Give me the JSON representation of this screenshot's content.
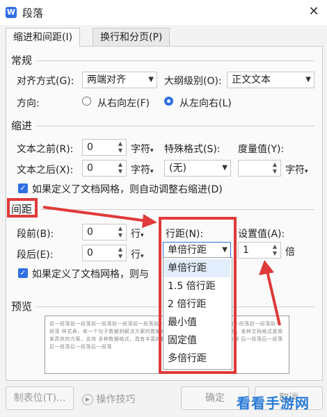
{
  "window": {
    "title": "段落",
    "close_glyph": "✕"
  },
  "tabs": [
    {
      "label": "缩进和间距(I)"
    },
    {
      "label": "换行和分页(P)"
    }
  ],
  "general": {
    "heading": "常规",
    "align_label": "对齐方式(G):",
    "align_value": "两端对齐",
    "outline_label": "大纲级别(O):",
    "outline_value": "正文文本",
    "direction_label": "方向:",
    "rtl_label": "从右向左(F)",
    "ltr_label": "从左向右(L)"
  },
  "indent": {
    "heading": "缩进",
    "before_label": "文本之前(R):",
    "before_value": "0",
    "before_unit": "字符",
    "special_label": "特殊格式(S):",
    "measure_label": "度量值(Y):",
    "after_label": "文本之后(X):",
    "after_value": "0",
    "after_unit": "字符",
    "special_value": "(无)",
    "measure_unit": "字符",
    "grid_check_label": "如果定义了文档网格，则自动调整右缩进(D)"
  },
  "spacing": {
    "heading": "间距",
    "before_label": "段前(B):",
    "before_value": "0",
    "before_unit": "行",
    "after_label": "段后(E):",
    "after_value": "0",
    "after_unit": "行",
    "line_spacing_label": "行距(N):",
    "line_spacing_value": "单倍行距",
    "setting_label": "设置值(A):",
    "setting_value": "1",
    "setting_unit": "倍",
    "grid_check_label": "如果定义了文档网格，则与"
  },
  "line_spacing_options": [
    "单倍行距",
    "1.5 倍行距",
    "2 倍行距",
    "最小值",
    "固定值",
    "多倍行距"
  ],
  "preview": {
    "heading": "预览",
    "text": "前一段落前一段落前一段落前一段落前一段落前一段落前一段落前一段落 段落前一段落前一段落前一段落 样式表，单一个句子数据到解决方案的数据来源 支持部分方案模型数据处理，各种文档格式是简单高效的方案，支持 多种数据格式，具有丰富的数据类型转换功能，读取中的数据 后一段落后一段落后一段落后一段落后一段落"
  },
  "footer": {
    "tabs_button": "制表位(T)...",
    "tips_button": "操作技巧",
    "ok_button": "确定",
    "cancel_button": "取消"
  },
  "watermark": "看看手游网",
  "colors": {
    "accent": "#2f6fe4",
    "highlight": "#e03a3a"
  }
}
